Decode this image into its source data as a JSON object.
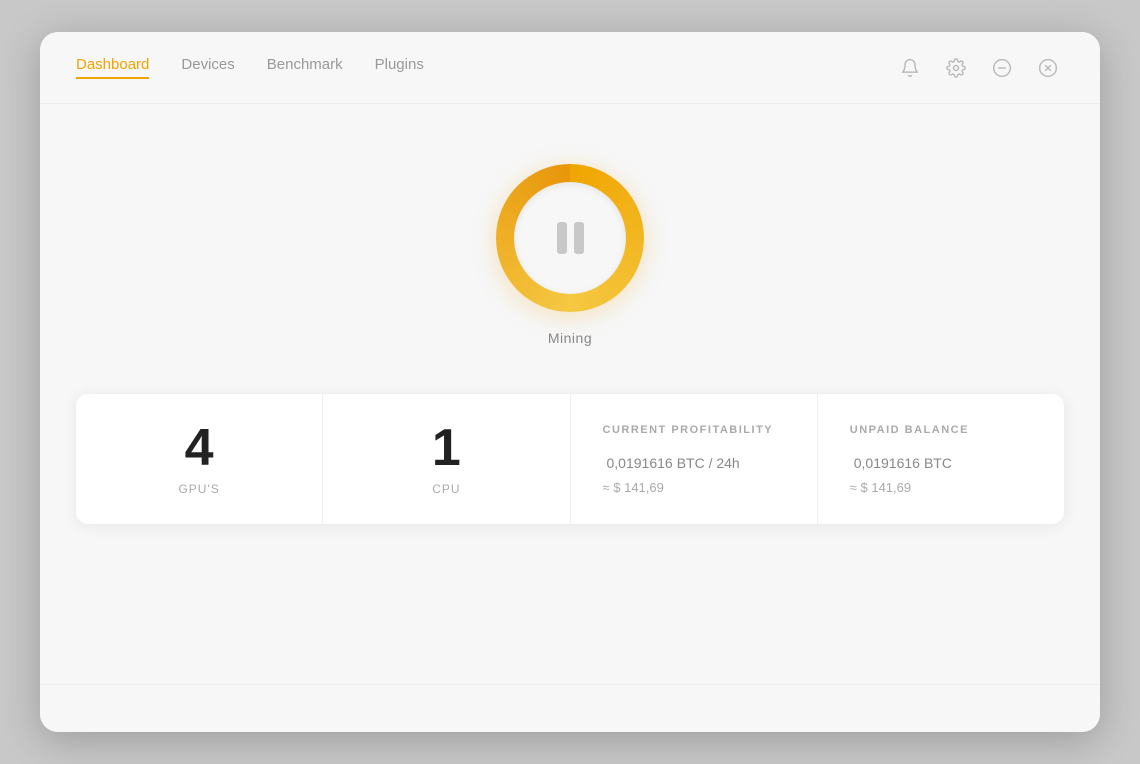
{
  "nav": {
    "tabs": [
      {
        "id": "dashboard",
        "label": "Dashboard",
        "active": true
      },
      {
        "id": "devices",
        "label": "Devices",
        "active": false
      },
      {
        "id": "benchmark",
        "label": "Benchmark",
        "active": false
      },
      {
        "id": "plugins",
        "label": "Plugins",
        "active": false
      }
    ],
    "icons": {
      "bell": "🔔",
      "settings": "⚙",
      "minimize": "−",
      "close": "✕"
    }
  },
  "mining": {
    "status_label": "Mining",
    "button_state": "paused"
  },
  "stats": {
    "gpu_count": "4",
    "gpu_label": "GPU'S",
    "cpu_count": "1",
    "cpu_label": "CPU",
    "profitability": {
      "header": "CURRENT PROFITABILITY",
      "value": "0,0191616",
      "unit": "BTC / 24h",
      "approx": "≈ $ 141,69"
    },
    "balance": {
      "header": "UNPAID BALANCE",
      "value": "0,0191616",
      "unit": "BTC",
      "approx": "≈ $ 141,69"
    }
  },
  "bottom": {
    "hint": ""
  }
}
